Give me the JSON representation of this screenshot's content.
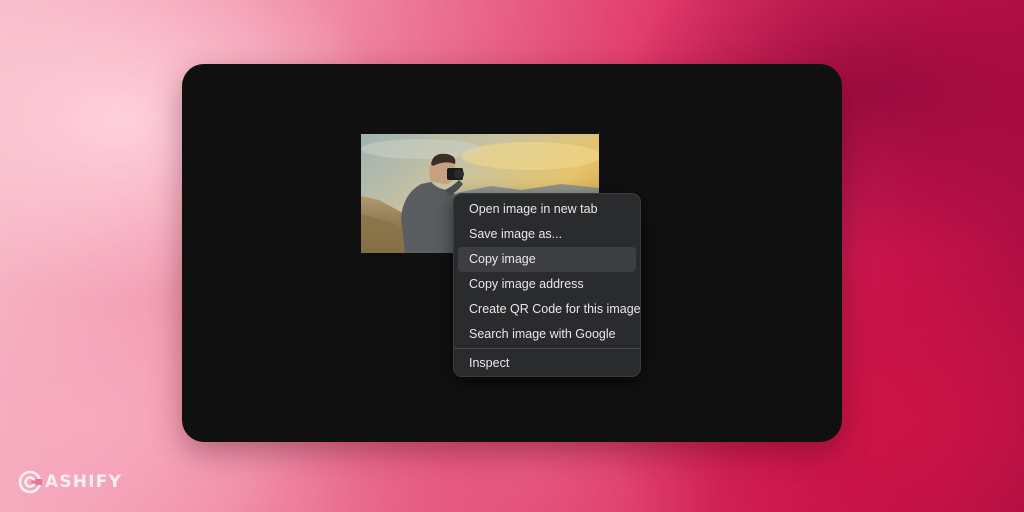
{
  "context_menu": {
    "items": [
      {
        "label": "Open image in new tab"
      },
      {
        "label": "Save image as..."
      },
      {
        "label": "Copy image"
      },
      {
        "label": "Copy image address"
      },
      {
        "label": "Create QR Code for this image"
      },
      {
        "label": "Search image with Google"
      },
      {
        "label": "Inspect"
      }
    ],
    "hovered_item": "Copy image"
  },
  "image": {
    "icon": "photo-of-photographer"
  },
  "brand": {
    "name": "ASHIFY",
    "icon": "cashify-logo-icon"
  },
  "colors": {
    "window_bg": "#101010",
    "menu_bg": "#2a2b2d",
    "menu_hover": "#3d3e41",
    "menu_text": "#e8e8ea"
  }
}
